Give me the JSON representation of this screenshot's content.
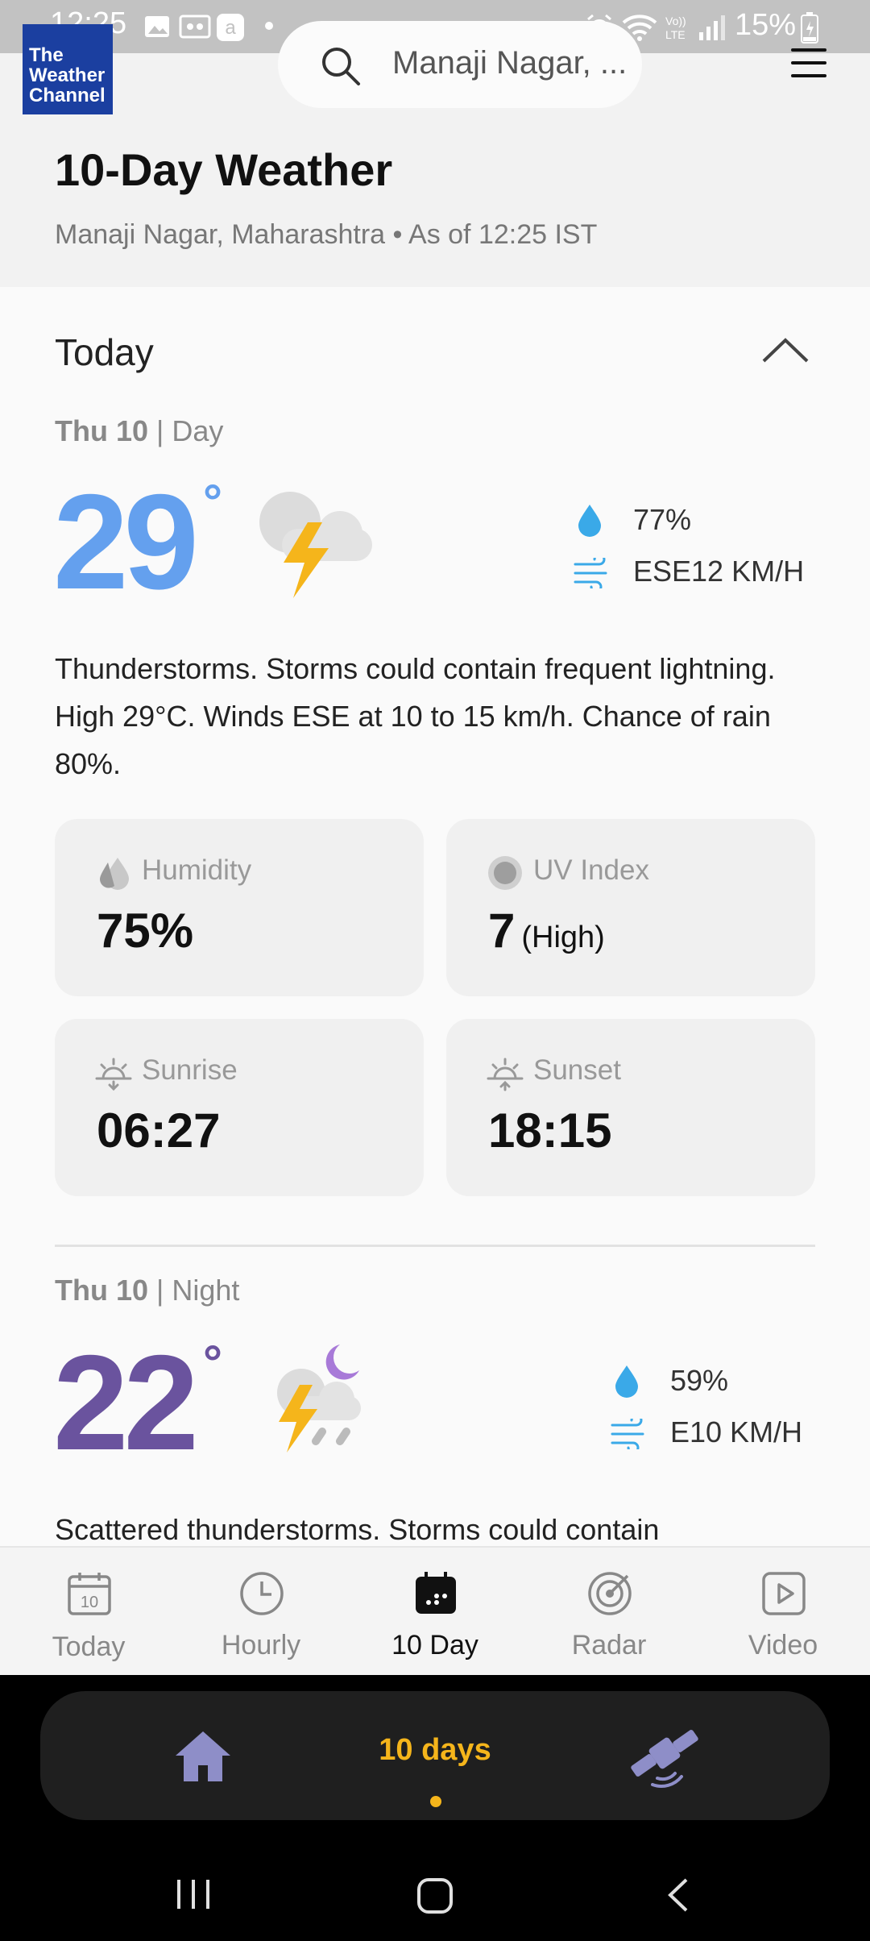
{
  "status_bar": {
    "time": "12:25",
    "battery": "15%"
  },
  "header": {
    "logo_text": "The Weather Channel",
    "search_text": "Manaji Nagar, ...",
    "title": "10-Day Weather",
    "subtitle": "Manaji Nagar, Maharashtra • As of 12:25 IST"
  },
  "section": {
    "label": "Today"
  },
  "day": {
    "date": "Thu 10",
    "period": "| Day",
    "temp": "29",
    "degree": "°",
    "precip": "77%",
    "wind": "ESE12 KM/H",
    "description": "Thunderstorms. Storms could contain frequent lightning. High 29°C. Winds ESE at 10 to 15 km/h. Chance of rain 80%.",
    "icon": "thunderstorm-cloud-icon"
  },
  "tiles": {
    "humidity": {
      "label": "Humidity",
      "value": "75%"
    },
    "uv": {
      "label": "UV Index",
      "value": "7",
      "sub": "(High)"
    },
    "sunrise": {
      "label": "Sunrise",
      "value": "06:27"
    },
    "sunset": {
      "label": "Sunset",
      "value": "18:15"
    }
  },
  "night": {
    "date": "Thu 10",
    "period": "| Night",
    "temp": "22",
    "degree": "°",
    "precip": "59%",
    "wind": "E10 KM/H",
    "description": "Scattered thunderstorms. Storms could contain",
    "icon": "night-thunderstorm-rain-icon"
  },
  "tabs": [
    {
      "label": "Today",
      "icon": "calendar-10-icon"
    },
    {
      "label": "Hourly",
      "icon": "clock-icon"
    },
    {
      "label": "10 Day",
      "icon": "calendar-dots-icon",
      "active": true
    },
    {
      "label": "Radar",
      "icon": "radar-icon"
    },
    {
      "label": "Video",
      "icon": "play-icon"
    }
  ],
  "bottom_nav": {
    "center_label": "10 days"
  },
  "colors": {
    "day_temp": "#64a0ee",
    "night_temp": "#6a539e",
    "accent": "#f5b51b",
    "drop": "#3aa9e8"
  }
}
